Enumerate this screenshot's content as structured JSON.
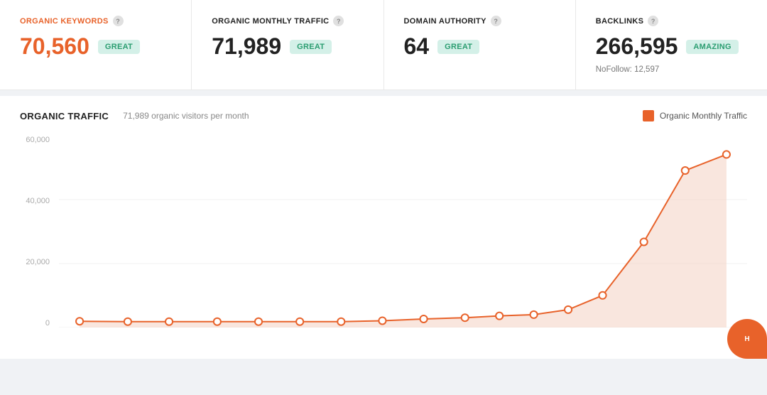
{
  "cards": [
    {
      "id": "organic-keywords",
      "title": "ORGANIC KEYWORDS",
      "title_color": "orange",
      "value": "70,560",
      "value_color": "orange",
      "badge": "GREAT",
      "badge_type": "great",
      "sub": null,
      "show_help": true
    },
    {
      "id": "organic-monthly-traffic",
      "title": "ORGANIC MONTHLY TRAFFIC",
      "title_color": "dark",
      "value": "71,989",
      "value_color": "dark",
      "badge": "GREAT",
      "badge_type": "great",
      "sub": null,
      "show_help": true
    },
    {
      "id": "domain-authority",
      "title": "DOMAIN AUTHORITY",
      "title_color": "dark",
      "value": "64",
      "value_color": "dark",
      "badge": "GREAT",
      "badge_type": "great",
      "sub": null,
      "show_help": true
    },
    {
      "id": "backlinks",
      "title": "BACKLINKS",
      "title_color": "dark",
      "value": "266,595",
      "value_color": "dark",
      "badge": "AMAZING",
      "badge_type": "amazing",
      "sub": "NoFollow: 12,597",
      "show_help": true
    }
  ],
  "chart": {
    "title": "ORGANIC TRAFFIC",
    "subtitle": "71,989 organic visitors per month",
    "legend_label": "Organic Monthly Traffic",
    "y_labels": [
      "0",
      "20,000",
      "40,000",
      "60,000"
    ],
    "data_points": [
      {
        "x": 0.03,
        "y": 0.035
      },
      {
        "x": 0.1,
        "y": 0.033
      },
      {
        "x": 0.16,
        "y": 0.033
      },
      {
        "x": 0.23,
        "y": 0.033
      },
      {
        "x": 0.29,
        "y": 0.033
      },
      {
        "x": 0.35,
        "y": 0.033
      },
      {
        "x": 0.41,
        "y": 0.033
      },
      {
        "x": 0.47,
        "y": 0.038
      },
      {
        "x": 0.53,
        "y": 0.048
      },
      {
        "x": 0.59,
        "y": 0.055
      },
      {
        "x": 0.64,
        "y": 0.065
      },
      {
        "x": 0.69,
        "y": 0.072
      },
      {
        "x": 0.74,
        "y": 0.1
      },
      {
        "x": 0.79,
        "y": 0.18
      },
      {
        "x": 0.85,
        "y": 0.48
      },
      {
        "x": 0.91,
        "y": 0.88
      },
      {
        "x": 0.97,
        "y": 0.97
      }
    ]
  },
  "chat_button": {
    "label": "H"
  }
}
